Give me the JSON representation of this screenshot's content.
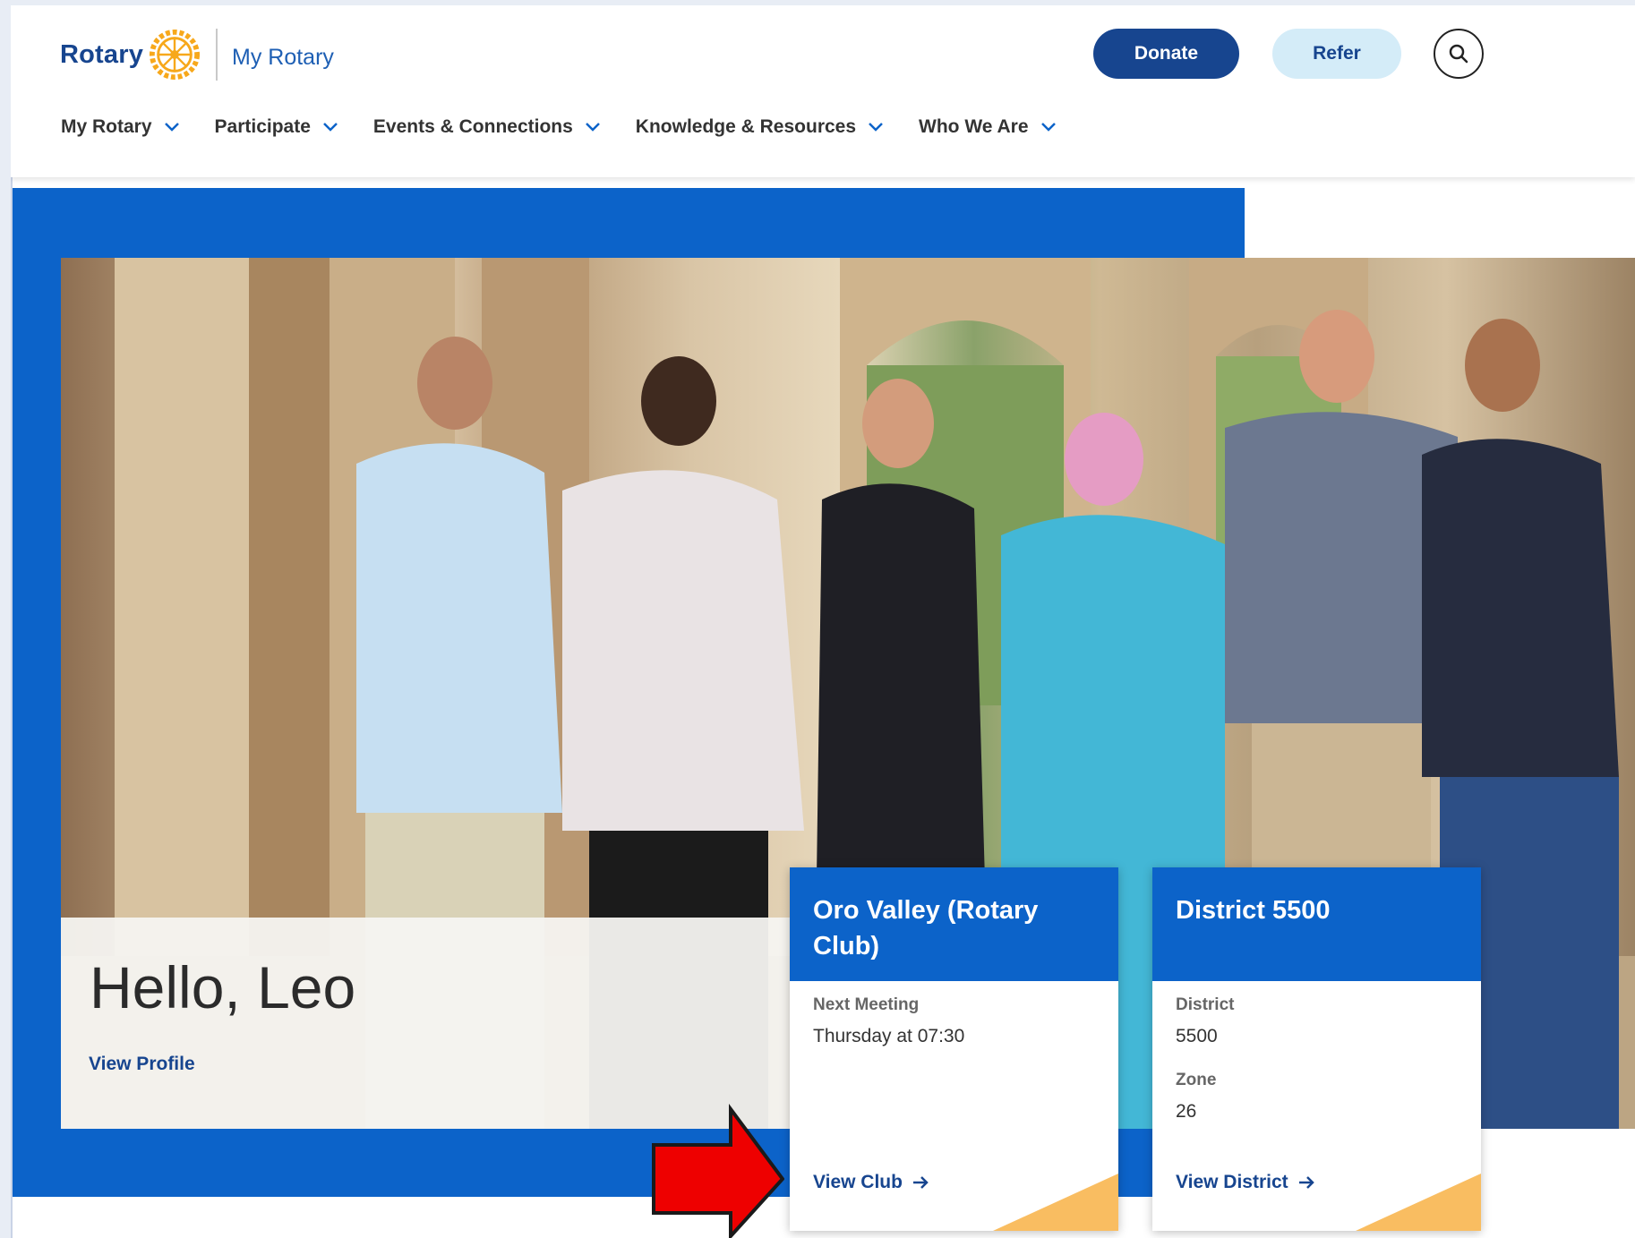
{
  "header": {
    "logo_text": "Rotary",
    "site_name": "My Rotary",
    "donate_label": "Donate",
    "refer_label": "Refer",
    "search_icon": "search-icon"
  },
  "nav": {
    "items": [
      {
        "label": "My Rotary"
      },
      {
        "label": "Participate"
      },
      {
        "label": "Events & Connections"
      },
      {
        "label": "Knowledge & Resources"
      },
      {
        "label": "Who We Are"
      }
    ]
  },
  "hero": {
    "greeting": "Hello, Leo",
    "view_profile": "View Profile"
  },
  "club_card": {
    "title": "Oro Valley (Rotary Club)",
    "next_meeting_label": "Next Meeting",
    "next_meeting_value": "Thursday at 07:30",
    "link_label": "View Club"
  },
  "district_card": {
    "title": "District 5500",
    "district_label": "District",
    "district_value": "5500",
    "zone_label": "Zone",
    "zone_value": "26",
    "link_label": "View District"
  },
  "colors": {
    "brand_blue": "#17458f",
    "hero_blue": "#0c63c9",
    "refer_bg": "#d4ecf8",
    "accent_gold": "#f7a81b",
    "annotation_red": "#ee0000"
  }
}
